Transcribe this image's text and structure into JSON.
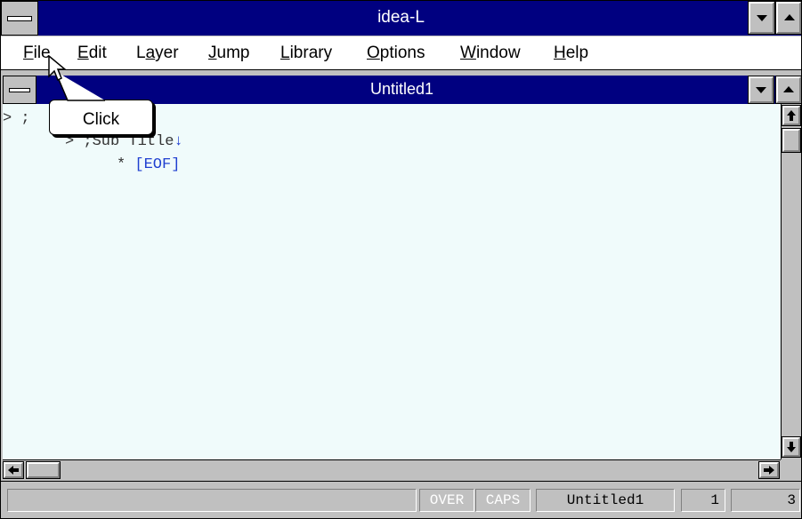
{
  "app": {
    "title": "idea-L"
  },
  "menu": [
    {
      "label": "File",
      "mnemonic": "F",
      "rest": "ile"
    },
    {
      "label": "Edit",
      "mnemonic": "E",
      "rest": "dit"
    },
    {
      "label": "Layer",
      "pre": "L",
      "mnemonic": "a",
      "rest": "yer"
    },
    {
      "label": "Jump",
      "mnemonic": "J",
      "rest": "ump"
    },
    {
      "label": "Library",
      "mnemonic": "L",
      "rest": "ibrary"
    },
    {
      "label": "Options",
      "mnemonic": "O",
      "rest": "ptions"
    },
    {
      "label": "Window",
      "mnemonic": "W",
      "rest": "indow"
    },
    {
      "label": "Help",
      "mnemonic": "H",
      "rest": "elp"
    }
  ],
  "document": {
    "title": "Untitled1",
    "lines": [
      {
        "prefix": ">",
        "text": ";"
      },
      {
        "prefix": ">",
        "text": ";Sub Title",
        "marker": "↓"
      },
      {
        "prefix": "*",
        "text": "[EOF]"
      }
    ]
  },
  "tooltip": {
    "label": "Click"
  },
  "status": {
    "over": "OVER",
    "caps": "CAPS",
    "filename": "Untitled1",
    "line": "1",
    "column": "3"
  }
}
